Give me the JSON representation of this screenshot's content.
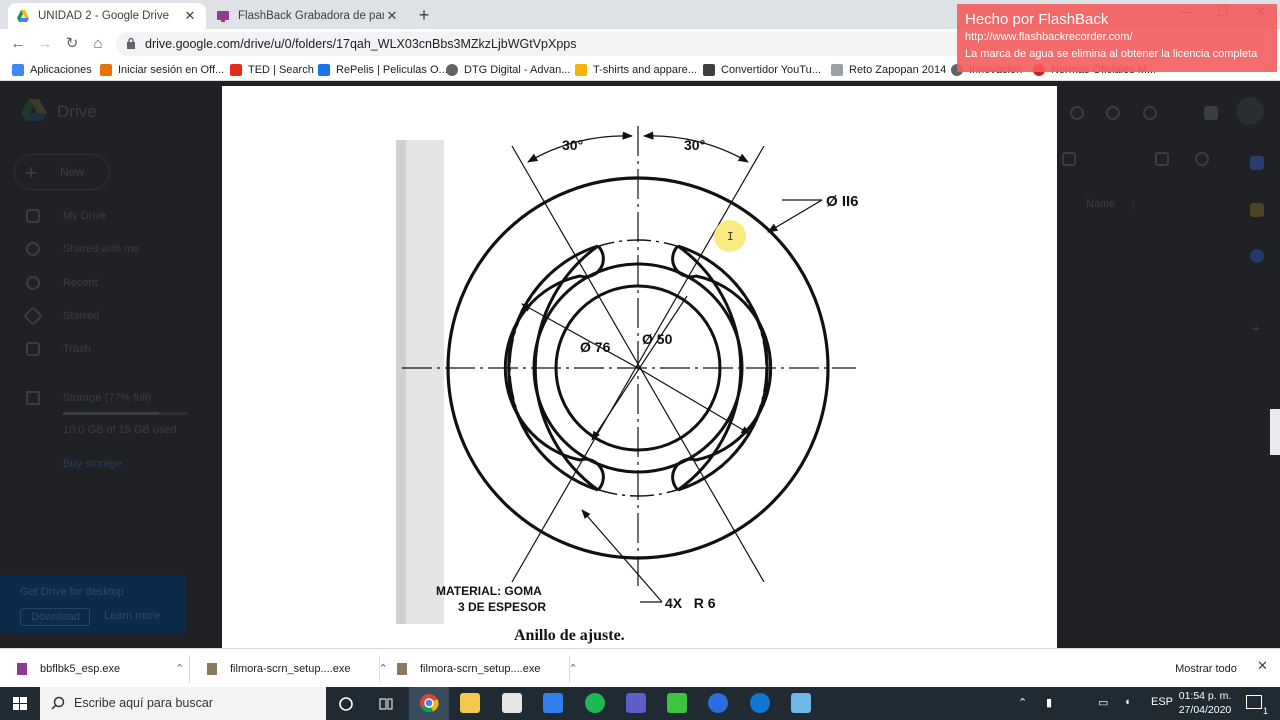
{
  "browser": {
    "tabs": [
      {
        "title": "UNIDAD 2 - Google Drive",
        "active": true
      },
      {
        "title": "FlashBack Grabadora de pantalla",
        "active": false
      }
    ],
    "url": "drive.google.com/drive/u/0/folders/17qah_WLX03cnBbs3MZkzLjbWGtVpXpps",
    "bookmarks": [
      {
        "label": "Aplicaciones",
        "color": "#4285f4"
      },
      {
        "label": "Iniciar sesión en Off...",
        "color": "#e8710a"
      },
      {
        "label": "TED | Search",
        "color": "#e62b1e"
      },
      {
        "label": "RePelis | Peliculas O...",
        "color": "#1a73e8"
      },
      {
        "label": "DTG Digital - Advan...",
        "color": "#5f6368"
      },
      {
        "label": "T-shirts and appare...",
        "color": "#f4b400"
      },
      {
        "label": "Convertidor YouTu...",
        "color": "#3c4043"
      },
      {
        "label": "Reto Zapopan 2014",
        "color": "#9aa0a6"
      },
      {
        "label": "Innovacion",
        "color": "#5f6368"
      },
      {
        "label": "Normas Oficiales M...",
        "color": "#c5221f"
      }
    ]
  },
  "watermark": {
    "title": "Hecho por FlashBack",
    "url": "http://www.flashbackrecorder.com/",
    "message": "La marca de agua se elimina al obtener la licencia completa"
  },
  "drive": {
    "logo": "Drive",
    "new_label": "New",
    "nav": [
      "My Drive",
      "Shared with me",
      "Recent",
      "Starred",
      "Trash"
    ],
    "storage_label": "Storage (77% full)",
    "storage_used": "10.0 GB of 15 GB used",
    "storage_fraction": 0.77,
    "buy_storage": "Buy storage",
    "get_drive_title": "Get Drive for desktop",
    "download": "Download",
    "learn_more": "Learn more",
    "sort_label": "Name"
  },
  "drawing": {
    "angle_left": "30°",
    "angle_right": "30°",
    "dia_outer": "Ø II6",
    "dia_76": "Ø 76",
    "dia_50": "Ø 50",
    "material_line1": "MATERIAL: GOMA",
    "material_line2": "3 DE ESPESOR",
    "slots": "4X   R 6",
    "caption": "Anillo de ajuste."
  },
  "downloads": {
    "items": [
      {
        "name": "bbflbk5_esp.exe"
      },
      {
        "name": "filmora-scrn_setup....exe"
      },
      {
        "name": "filmora-scrn_setup....exe"
      }
    ],
    "show_all": "Mostrar todo"
  },
  "taskbar": {
    "search_placeholder": "Escribe aquí para buscar",
    "lang": "ESP",
    "time": "01:54 p. m.",
    "date": "27/04/2020",
    "notification_count": "1"
  }
}
